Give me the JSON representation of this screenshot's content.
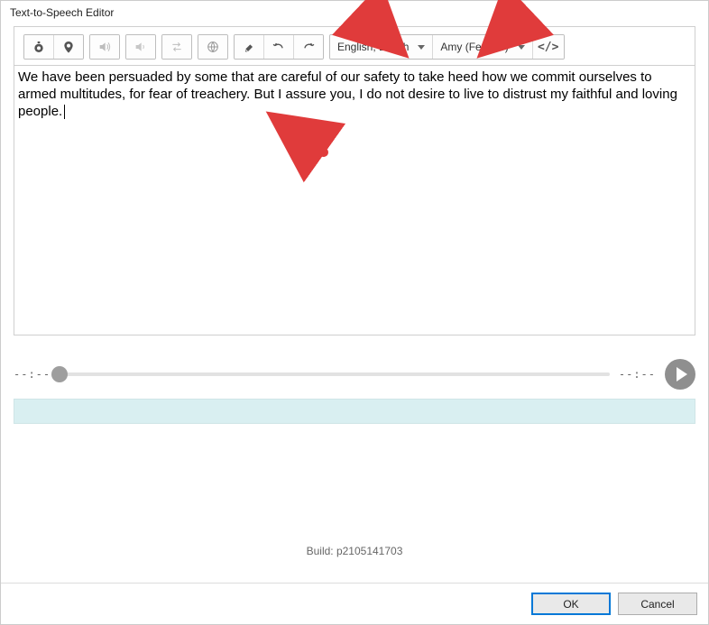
{
  "title": "Text-to-Speech Editor",
  "toolbar": {
    "language": "English, British",
    "voice": "Amy (Female)",
    "code": "</>"
  },
  "editor": {
    "text": "We have been persuaded by some that are careful of our safety to take heed how we commit ourselves to armed multitudes, for fear of treachery. But I assure you, I do not desire to live to distrust my faithful and loving people."
  },
  "player": {
    "elapsed": "--:--",
    "remaining": "--:--"
  },
  "build": "Build: p2105141703",
  "buttons": {
    "ok": "OK",
    "cancel": "Cancel"
  }
}
